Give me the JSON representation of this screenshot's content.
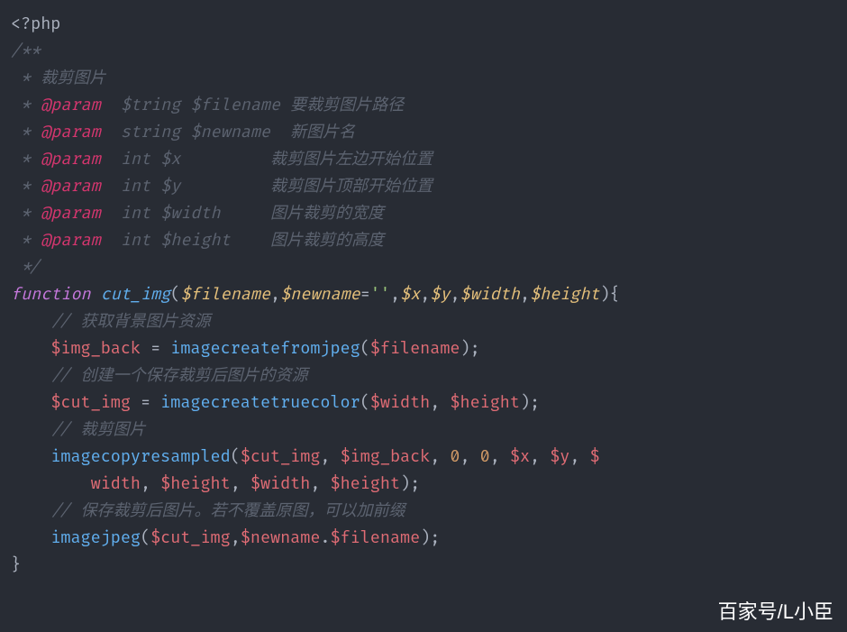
{
  "php_open": "<?php",
  "doc_open": "/**",
  "doc_title": " * 裁剪图片",
  "p1_a": " * ",
  "p1_tag": "@param",
  "p1_b": "  $tring $filename 要裁剪图片路径",
  "p2_a": " * ",
  "p2_tag": "@param",
  "p2_b": "  string $newname  新图片名",
  "p3_a": " * ",
  "p3_tag": "@param",
  "p3_b": "  int $x         裁剪图片左边开始位置",
  "p4_a": " * ",
  "p4_tag": "@param",
  "p4_b": "  int $y         裁剪图片顶部开始位置",
  "p5_a": " * ",
  "p5_tag": "@param",
  "p5_b": "  int $width     图片裁剪的宽度",
  "p6_a": " * ",
  "p6_tag": "@param",
  "p6_b": "  int $height    图片裁剪的高度",
  "doc_close": " */",
  "fn_kw": "function",
  "fn_name": "cut_img",
  "arg_filename": "$filename",
  "arg_newname": "$newname",
  "arg_eq": "=",
  "arg_str": "''",
  "arg_x": "$x",
  "arg_y": "$y",
  "arg_w": "$width",
  "arg_h": "$height",
  "open_brace": "){",
  "c1": "// 获取背景图片资源",
  "l1_var": "$img_back",
  "l1_eq": " = ",
  "l1_fn": "imagecreatefromjpeg",
  "l1_arg": "$filename",
  "c2": "// 创建一个保存裁剪后图片的资源",
  "l2_var": "$cut_img",
  "l2_eq": " = ",
  "l2_fn": "imagecreatetruecolor",
  "l2_a1": "$width",
  "l2_a2": "$height",
  "c3": "// 裁剪图片",
  "l3_fn": "imagecopyresampled",
  "l3_a1": "$cut_img",
  "l3_a2": "$img_back",
  "l3_n0a": "0",
  "l3_n0b": "0",
  "l3_a3": "$x",
  "l3_a4": "$y",
  "l3_a5": "$",
  "l3_cont1": "width",
  "l3_a6": "$height",
  "l3_a7": "$width",
  "l3_a8": "$height",
  "c4": "// 保存裁剪后图片。若不覆盖原图，可以加前缀",
  "l4_fn": "imagejpeg",
  "l4_a1": "$cut_img",
  "l4_a2": "$newname",
  "l4_dot": ".",
  "l4_a3": "$filename",
  "close_brace": "}",
  "watermark": "百家号/L小臣"
}
